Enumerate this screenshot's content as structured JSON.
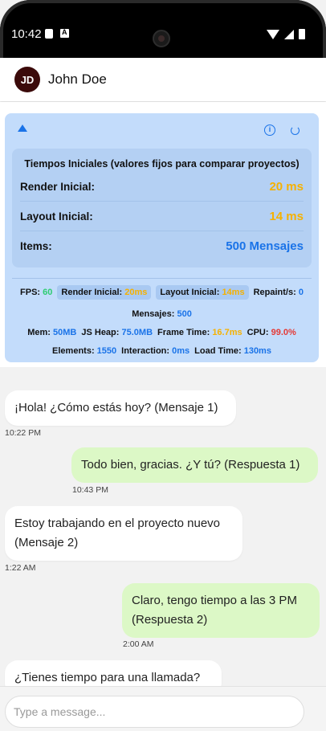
{
  "status_bar": {
    "time": "10:42"
  },
  "header": {
    "avatar_initials": "JD",
    "name": "John Doe"
  },
  "metrics": {
    "inner_title": "Tiempos Iniciales (valores fijos para comparar proyectos)",
    "rows": [
      {
        "label": "Render Inicial:",
        "value": "20 ms",
        "color": "#f5b100"
      },
      {
        "label": "Layout Inicial:",
        "value": "14 ms",
        "color": "#f5b100"
      },
      {
        "label": "Items:",
        "value": "500 Mensajes",
        "color": "#1a73e8"
      }
    ],
    "fps_label": "FPS:",
    "fps": "60",
    "render_label": "Render Inicial:",
    "render": "20ms",
    "layout_label": "Layout Inicial:",
    "layout": "14ms",
    "repaint_label": "Repaint/s:",
    "repaint": "0",
    "mensajes_label": "Mensajes:",
    "mensajes": "500",
    "mem_label": "Mem:",
    "mem": "50MB",
    "heap_label": "JS Heap:",
    "heap": "75.0MB",
    "frame_label": "Frame Time:",
    "frame": "16.7ms",
    "cpu_label": "CPU:",
    "cpu": "99.0%",
    "elements_label": "Elements:",
    "elements": "1550",
    "interaction_label": "Interaction:",
    "interaction": "0ms",
    "load_label": "Load Time:",
    "load": "130ms"
  },
  "messages": [
    {
      "side": "in",
      "text": "¡Hola! ¿Cómo estás hoy? (Mensaje 1)",
      "time": "10:22 PM"
    },
    {
      "side": "out",
      "text": "Todo bien, gracias. ¿Y tú? (Respuesta 1)",
      "time": "10:43 PM"
    },
    {
      "side": "in",
      "text": "Estoy trabajando en el proyecto nuevo (Mensaje 2)",
      "time": "1:22 AM"
    },
    {
      "side": "out",
      "text": "Claro, tengo tiempo a las 3 PM (Respuesta 2)",
      "time": "2:00 AM"
    },
    {
      "side": "in",
      "text": "¿Tienes tiempo para una llamada?",
      "time": ""
    }
  ],
  "composer": {
    "placeholder": "Type a message..."
  },
  "colors": {
    "accent": "#1a73e8",
    "panel": "#c3dcfb",
    "outgoing_bubble": "#dcf8c6",
    "warning": "#f5b100",
    "good": "#2ecc71",
    "danger": "#e53935"
  }
}
